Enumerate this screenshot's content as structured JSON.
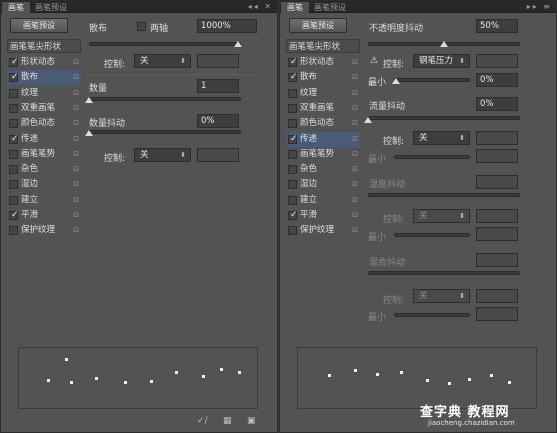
{
  "left": {
    "tabs": [
      "画笔",
      "画笔预设"
    ],
    "tab_controls": "◂◂ ✕",
    "preset_button": "画笔预设",
    "sidebar_title": "画笔笔尖形状",
    "sidebar": [
      {
        "label": "形状动态",
        "checked": true,
        "selected": false
      },
      {
        "label": "散布",
        "checked": true,
        "selected": true
      },
      {
        "label": "纹理",
        "checked": false,
        "selected": false
      },
      {
        "label": "双重画笔",
        "checked": false,
        "selected": false
      },
      {
        "label": "颜色动态",
        "checked": false,
        "selected": false
      },
      {
        "label": "传递",
        "checked": true,
        "selected": false
      },
      {
        "label": "画笔笔势",
        "checked": false,
        "selected": false
      },
      {
        "label": "杂色",
        "checked": false,
        "selected": false
      },
      {
        "label": "湿边",
        "checked": false,
        "selected": false
      },
      {
        "label": "建立",
        "checked": false,
        "selected": false
      },
      {
        "label": "平滑",
        "checked": true,
        "selected": false
      },
      {
        "label": "保护纹理",
        "checked": false,
        "selected": false
      }
    ],
    "scatter": {
      "label": "散布",
      "both_axes_label": "两轴",
      "value": "1000%"
    },
    "control1": {
      "label": "控制:",
      "value": "关"
    },
    "count": {
      "label": "数量",
      "value": "1"
    },
    "count_jitter": {
      "label": "数量抖动",
      "value": "0%"
    },
    "control2": {
      "label": "控制:",
      "value": "关"
    }
  },
  "right": {
    "tabs": [
      "画笔",
      "画笔预设"
    ],
    "tab_controls": "▸▸ ≡",
    "preset_button": "画笔预设",
    "sidebar_title": "画笔笔尖形状",
    "sidebar": [
      {
        "label": "形状动态",
        "checked": true,
        "selected": false
      },
      {
        "label": "散布",
        "checked": true,
        "selected": false
      },
      {
        "label": "纹理",
        "checked": false,
        "selected": false
      },
      {
        "label": "双重画笔",
        "checked": false,
        "selected": false
      },
      {
        "label": "颜色动态",
        "checked": false,
        "selected": false
      },
      {
        "label": "传递",
        "checked": true,
        "selected": true
      },
      {
        "label": "画笔笔势",
        "checked": false,
        "selected": false
      },
      {
        "label": "杂色",
        "checked": false,
        "selected": false
      },
      {
        "label": "湿边",
        "checked": false,
        "selected": false
      },
      {
        "label": "建立",
        "checked": false,
        "selected": false
      },
      {
        "label": "平滑",
        "checked": true,
        "selected": false
      },
      {
        "label": "保护纹理",
        "checked": false,
        "selected": false
      }
    ],
    "opacity_jitter": {
      "label": "不透明度抖动",
      "value": "50%"
    },
    "control1": {
      "label": "控制:",
      "value": "钢笔压力"
    },
    "min1": {
      "label": "最小",
      "value": "0%"
    },
    "flow_jitter": {
      "label": "流量抖动",
      "value": "0%"
    },
    "control2": {
      "label": "控制:",
      "value": "关"
    },
    "min2": {
      "label": "最小"
    },
    "wetness_jitter": {
      "label": "湿度抖动"
    },
    "control3": {
      "label": "控制:",
      "value": "关"
    },
    "min3": {
      "label": "最小"
    },
    "mix_jitter": {
      "label": "混合抖动"
    },
    "control4": {
      "label": "控制:",
      "value": "关"
    },
    "min4": {
      "label": "最小"
    }
  },
  "watermark": {
    "main": "查字典 教程网",
    "sub": "jiaocheng.chazidian.com"
  },
  "icons": [
    "lock-icon",
    "check-icon",
    "warning-icon",
    "dropdown-arrow-icon",
    "new-brush-icon",
    "grid-icon",
    "trash-icon"
  ]
}
